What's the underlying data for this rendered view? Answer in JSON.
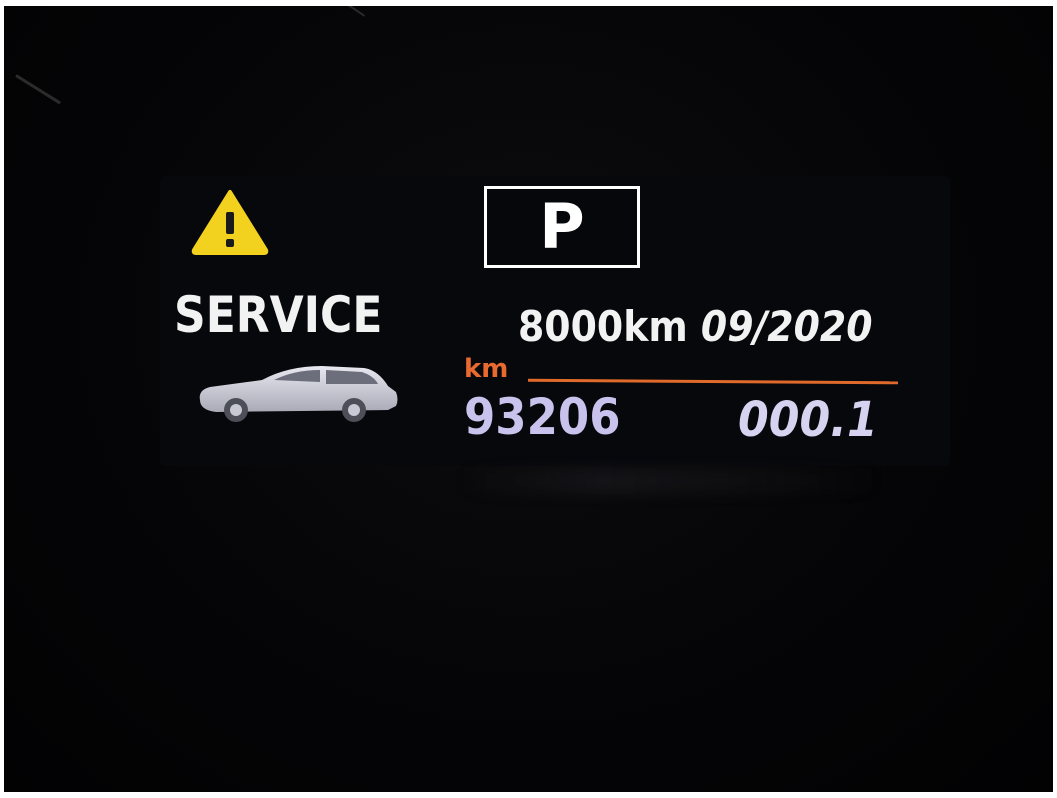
{
  "display": {
    "gear": "P",
    "service": {
      "label": "SERVICE",
      "distance": "8000km",
      "date": "09/2020"
    },
    "odometer": {
      "unit": "km",
      "total": "93206",
      "trip": "000.1"
    }
  },
  "icons": {
    "warning": "warning-triangle-icon",
    "car": "car-icon"
  },
  "colors": {
    "warning": "#f2d21e",
    "accent_line": "#e06a2c",
    "odometer_text": "#c9c2ec",
    "text": "#f2f2f2"
  }
}
